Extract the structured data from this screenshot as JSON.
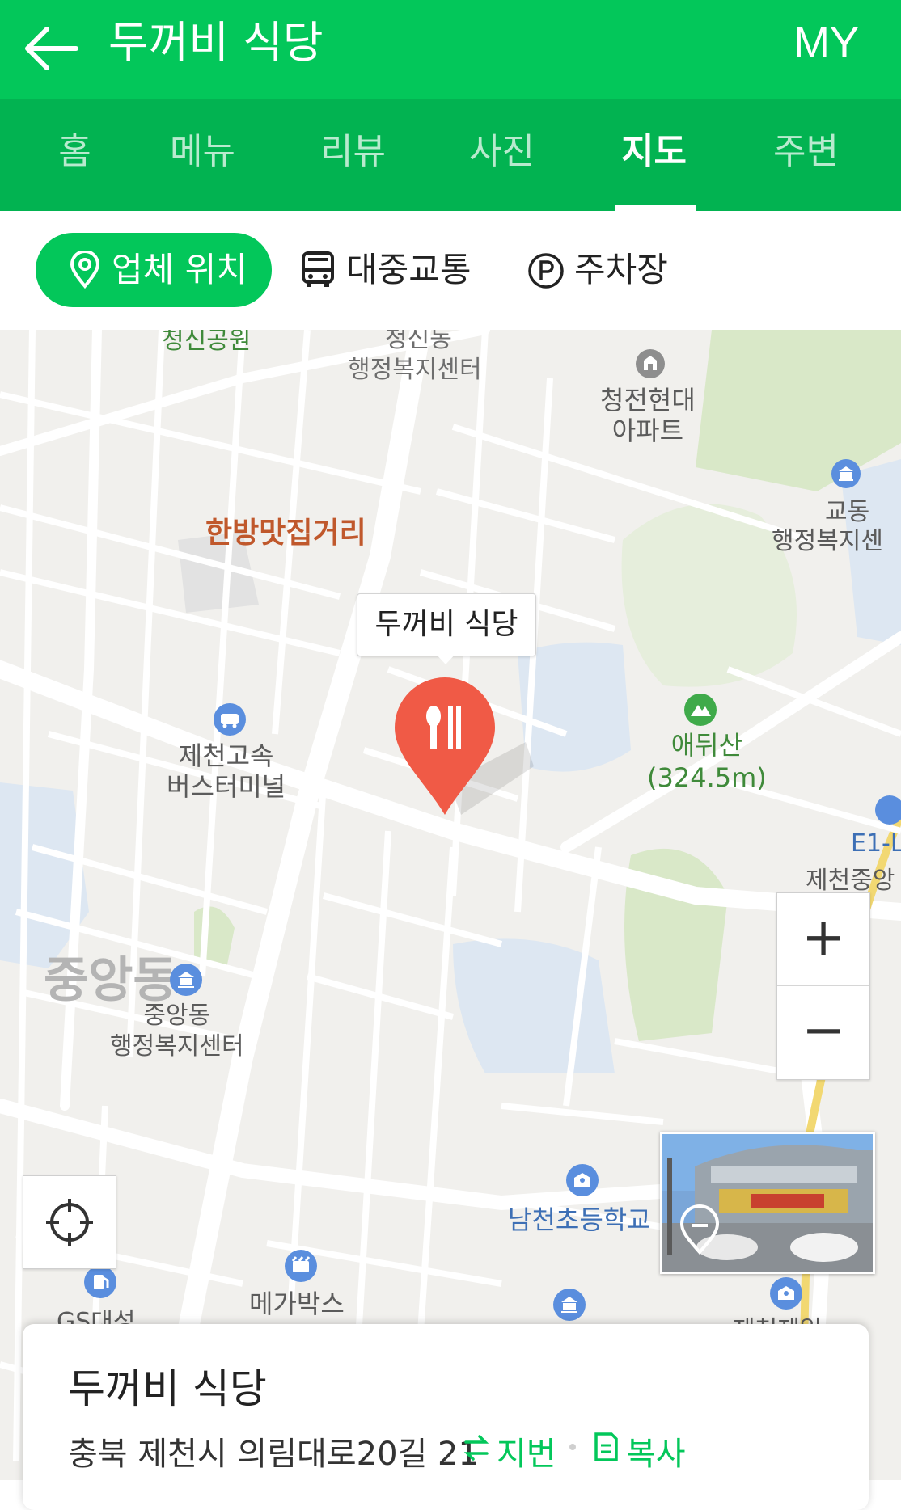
{
  "header": {
    "title": "두꺼비 식당",
    "my_label": "MY"
  },
  "tabs": [
    {
      "label": "홈"
    },
    {
      "label": "메뉴"
    },
    {
      "label": "리뷰"
    },
    {
      "label": "사진"
    },
    {
      "label": "지도",
      "active": true
    },
    {
      "label": "주변"
    }
  ],
  "subtabs": {
    "location": "업체 위치",
    "transit": "대중교통",
    "parking": "주차장"
  },
  "map": {
    "marker_callout": "두꺼비 식당",
    "labels": {
      "cheongsin_park": "청신공원",
      "cheongsin_office_1": "청신동",
      "cheongsin_office_2": "행정복지센터",
      "apt_1": "청전현대",
      "apt_2": "아파트",
      "gyodong_1": "교동",
      "gyodong_2": "행정복지센",
      "hanbang": "한방맛집거리",
      "terminal_1": "제천고속",
      "terminal_2": "버스터미널",
      "aedwisan_1": "애뒤산",
      "aedwisan_2": "(324.5m)",
      "e1": "E1-L",
      "jecheon_jung": "제천중앙",
      "jungang_big": "중앙동",
      "jungang_office_1": "중앙동",
      "jungang_office_2": "행정복지센터",
      "namcheon": "남천초등학교",
      "megabox": "메가박스",
      "gs": "GS대성",
      "jecheon_bottom": "제천제일"
    },
    "zoom_in": "+",
    "zoom_out": "−"
  },
  "card": {
    "name": "두꺼비 식당",
    "address": "충북 제천시 의림대로20길 21",
    "jibun": "지번",
    "copy": "복사"
  },
  "colors": {
    "accent": "#03c75a",
    "tab_bg": "#02b351",
    "marker": "#f05a46",
    "water": "#dde7f2",
    "green": "#d9e8c8"
  }
}
